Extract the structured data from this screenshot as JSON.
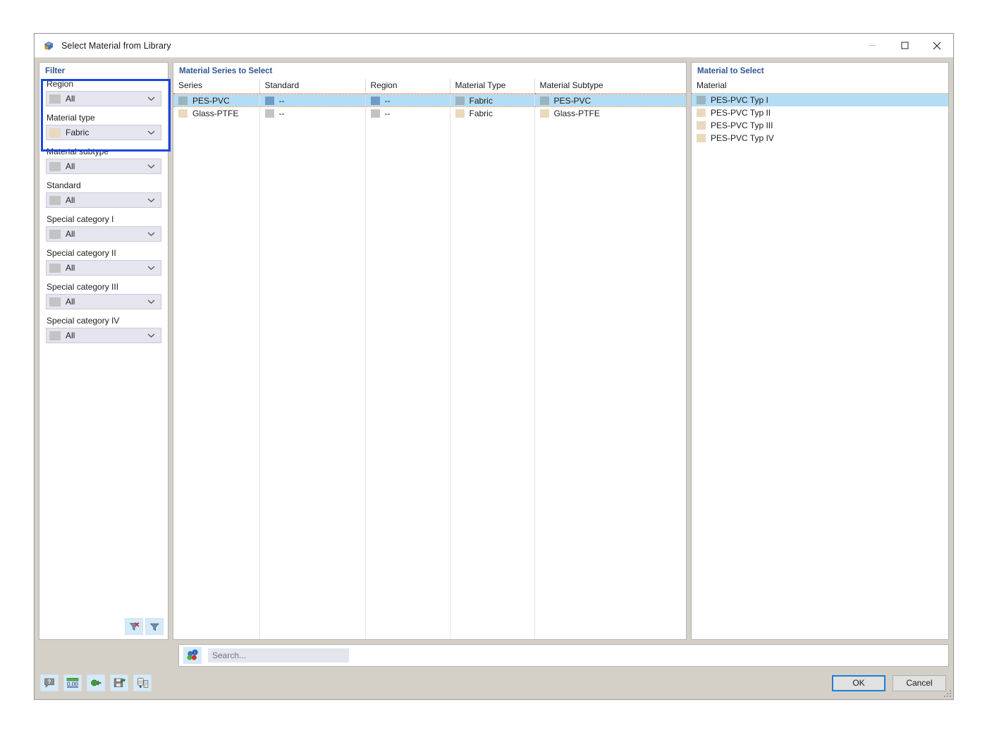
{
  "window": {
    "title": "Select Material from Library",
    "app_icon": "material-library-icon",
    "minimize_label": "–",
    "maximize_label": "□",
    "close_label": "✕"
  },
  "filter": {
    "caption": "Filter",
    "highlighted_groups": [
      "Region",
      "Material type"
    ],
    "groups": [
      {
        "label": "Region",
        "value": "All",
        "swatch": "#c3c3c3"
      },
      {
        "label": "Material type",
        "value": "Fabric",
        "swatch": "#ead9bd"
      },
      {
        "label": "Material subtype",
        "value": "All",
        "swatch": "#c3c3c3"
      },
      {
        "label": "Standard",
        "value": "All",
        "swatch": "#c3c3c3"
      },
      {
        "label": "Special category I",
        "value": "All",
        "swatch": "#c3c3c3"
      },
      {
        "label": "Special category II",
        "value": "All",
        "swatch": "#c3c3c3"
      },
      {
        "label": "Special category III",
        "value": "All",
        "swatch": "#c3c3c3"
      },
      {
        "label": "Special category IV",
        "value": "All",
        "swatch": "#c3c3c3"
      }
    ],
    "buttons": [
      {
        "name": "reset-filter-button",
        "icon": "funnel-with-red-x-icon"
      },
      {
        "name": "apply-filter-button",
        "icon": "funnel-icon"
      }
    ]
  },
  "series_panel": {
    "caption": "Material Series to Select",
    "columns": [
      "Series",
      "Standard",
      "Region",
      "Material Type",
      "Material Subtype"
    ],
    "rows": [
      {
        "selected": true,
        "swatch": "#9bb3bd",
        "cells": [
          {
            "text": "PES-PVC",
            "swatch": "#9bb3bd"
          },
          {
            "text": "--",
            "swatch": "#6e9cc4"
          },
          {
            "text": "--",
            "swatch": "#6e9cc4"
          },
          {
            "text": "Fabric",
            "swatch": "#9bb3bd"
          },
          {
            "text": "PES-PVC",
            "swatch": "#9bb3bd"
          }
        ]
      },
      {
        "selected": false,
        "swatch": "#ead9bd",
        "cells": [
          {
            "text": "Glass-PTFE",
            "swatch": "#ead9bd"
          },
          {
            "text": "--",
            "swatch": "#c3c3c3"
          },
          {
            "text": "--",
            "swatch": "#c3c3c3"
          },
          {
            "text": "Fabric",
            "swatch": "#ead9bd"
          },
          {
            "text": "Glass-PTFE",
            "swatch": "#ead9bd"
          }
        ]
      }
    ]
  },
  "material_panel": {
    "caption": "Material to Select",
    "column": "Material",
    "items": [
      {
        "text": "PES-PVC Typ I",
        "swatch": "#9bb3bd",
        "selected": true
      },
      {
        "text": "PES-PVC Typ II",
        "swatch": "#ead9bd",
        "selected": false
      },
      {
        "text": "PES-PVC Typ III",
        "swatch": "#ead9bd",
        "selected": false
      },
      {
        "text": "PES-PVC Typ IV",
        "swatch": "#ead9bd",
        "selected": false
      }
    ]
  },
  "search": {
    "icon": "color-balls-info-icon",
    "placeholder": "Search...",
    "value": ""
  },
  "footer": {
    "tools": [
      {
        "name": "info-button",
        "icon": "question-bubble-icon"
      },
      {
        "name": "units-button",
        "icon": "ruler-number-icon",
        "label": "0,00"
      },
      {
        "name": "import-button",
        "icon": "green-plug-icon"
      },
      {
        "name": "save-library-button",
        "icon": "green-floppy-icon"
      },
      {
        "name": "database-export-button",
        "icon": "database-document-icon"
      }
    ],
    "ok_label": "OK",
    "cancel_label": "Cancel"
  },
  "colors": {
    "caption_blue": "#31568f",
    "selection_blue": "#b5dcf5",
    "focus_blue": "#1c47e0",
    "button_focus": "#1c7fd6",
    "dialog_gray": "#d4d0c8",
    "combo_fill": "#e4e5ee",
    "row_dotted": "#e08a4a"
  }
}
